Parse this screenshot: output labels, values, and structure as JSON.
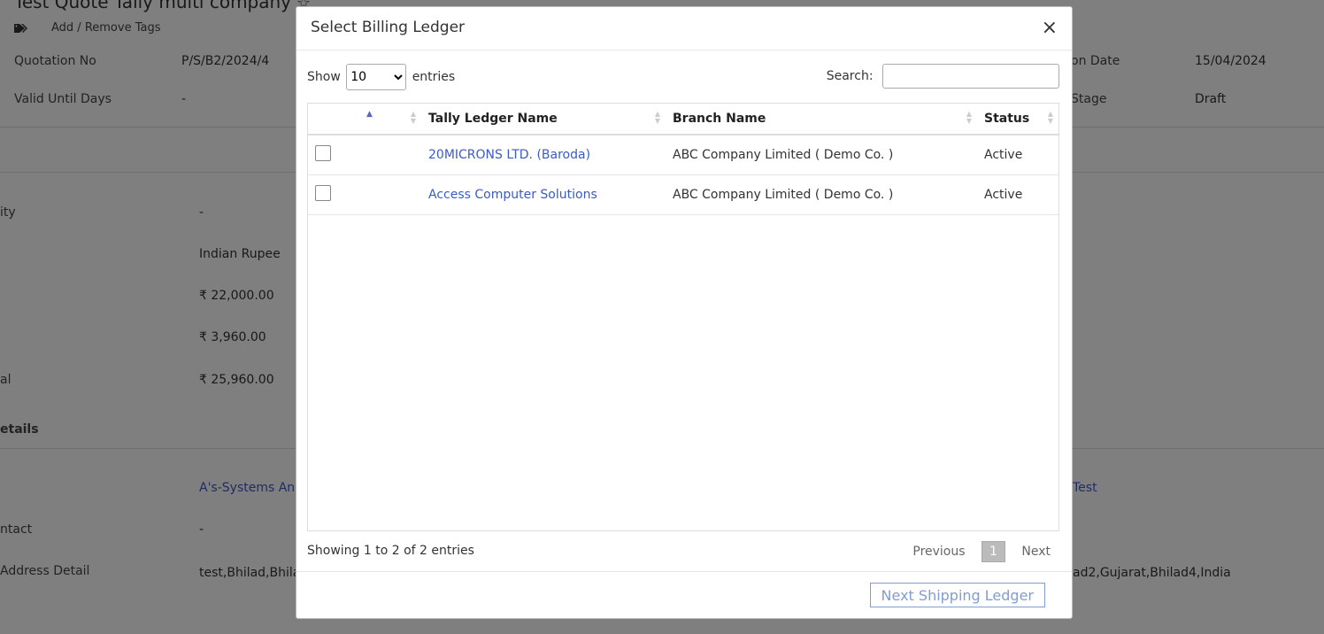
{
  "background": {
    "title": "Test Quote Tally multi company",
    "tags_label": "Add / Remove Tags",
    "quotation_no_label": "Quotation No",
    "quotation_no": "P/S/B2/2024/4",
    "quotation_date_label": "on Date",
    "quotation_date": "15/04/2024",
    "valid_until_label": "Valid Until Days",
    "valid_until": "-",
    "stage_label": "Stage",
    "stage": "Draft",
    "row1_label": "ity",
    "row1_value": "-",
    "currency_value": "Indian Rupee",
    "amount_value": "₹ 22,000.00",
    "tax_value": "₹ 3,960.00",
    "total_label": "al",
    "total_value": "₹ 25,960.00",
    "details_heading": "etails",
    "company_link": "A's-Systems An",
    "right_link": "Test",
    "contact_label": "ntact",
    "contact_value": "-",
    "address_label": "Address Detail",
    "address_value": "test,Bhilad,Bhila",
    "address_right": "ad2,Gujarat,Bhilad4,India"
  },
  "modal": {
    "title": "Select Billing Ledger",
    "close_symbol": "×",
    "show_label": "Show",
    "entries_label": "entries",
    "length_selected": "10",
    "search_label": "Search:",
    "search_value": "",
    "columns": [
      "",
      "Tally Ledger Name",
      "Branch Name",
      "Status"
    ],
    "rows": [
      {
        "ledger": "20MICRONS LTD. (Baroda)",
        "branch": "ABC Company Limited ( Demo Co. )",
        "status": "Active"
      },
      {
        "ledger": "Access Computer Solutions",
        "branch": "ABC Company Limited ( Demo Co. )",
        "status": "Active"
      }
    ],
    "info": "Showing 1 to 2 of 2 entries",
    "previous_label": "Previous",
    "current_page": "1",
    "next_label": "Next",
    "next_button": "Next Shipping Ledger"
  },
  "colors": {
    "link": "#3a5bc7",
    "sort_active": "#5865c2",
    "overlay": "rgba(0,0,0,0.5)"
  }
}
